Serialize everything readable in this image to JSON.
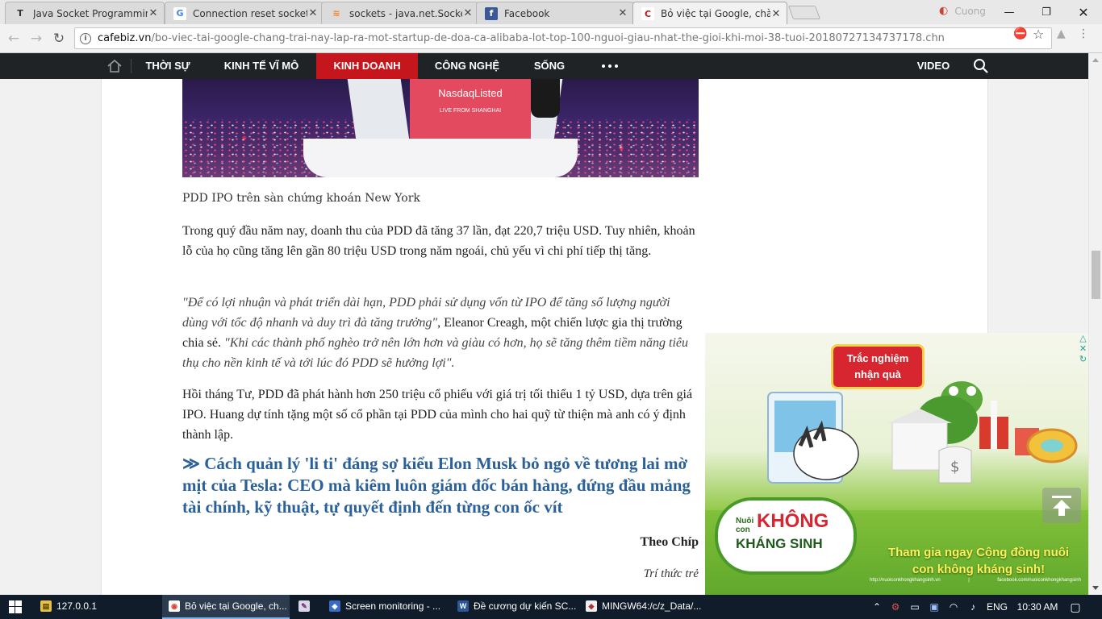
{
  "browser": {
    "tabs": [
      {
        "title": "Java Socket Programming",
        "icon": "T",
        "icon_bg": "#dbdbdb",
        "icon_fg": "#333"
      },
      {
        "title": "Connection reset socket j",
        "icon": "G",
        "icon_bg": "#ffffff",
        "icon_fg": "#4285f4"
      },
      {
        "title": "sockets - java.net.SocketE",
        "icon": "≋",
        "icon_bg": "#dbdbdb",
        "icon_fg": "#f48024"
      },
      {
        "title": "Facebook",
        "icon": "f",
        "icon_bg": "#3b5998",
        "icon_fg": "#ffffff"
      },
      {
        "title": "Bỏ việc tại Google, chàng",
        "icon": "C",
        "icon_bg": "#ffffff",
        "icon_fg": "#c4161c"
      }
    ],
    "tab_close_glyph": "✕",
    "profile_name": "Cuong",
    "url_host": "cafebiz.vn",
    "url_path": "/bo-viec-tai-google-chang-trai-nay-lap-ra-mot-startup-de-doa-ca-alibaba-lot-top-100-nguoi-giau-nhat-the-gioi-khi-moi-38-tuoi-20180727134737178.chn"
  },
  "site_nav": {
    "items": [
      "THỜI SỰ",
      "KINH TẾ VĨ MÔ",
      "KINH DOANH",
      "CÔNG NGHỆ",
      "SỐNG"
    ],
    "active_item": "KINH DOANH",
    "video_label": "VIDEO",
    "accent_color": "#c4161c"
  },
  "article": {
    "photo_screen_text": "NasdaqListed",
    "photo_screen_subtext": "LIVE FROM SHANGHAI",
    "caption": "PDD IPO trên sàn chứng khoán New York",
    "paragraph_1": "Trong quý đầu năm nay, doanh thu của PDD đã tăng 37 lần, đạt 220,7 triệu USD. Tuy nhiên, khoản lỗ của họ cũng tăng lên gần 80 triệu USD trong năm ngoái, chủ yếu vì chi phí tiếp thị tăng.",
    "quote_1": "\"Để có lợi nhuận và phát triển dài hạn, PDD phải sử dụng vốn từ IPO để tăng số lượng người dùng với tốc độ nhanh và duy trì đà tăng trưởng\"",
    "quote_attribution": ", Eleanor Creagh, một chiến lược gia thị trường chia sẻ. ",
    "quote_2": "\"Khi các thành phố nghèo trở nên lớn hơn và giàu có hơn, họ sẽ tăng thêm tiềm năng tiêu thụ cho nền kinh tế và tới lúc đó PDD sẽ hưởng lợi\".",
    "paragraph_3": "Hồi tháng Tư, PDD đã phát hành hơn 250 triệu cổ phiếu với giá trị tối thiểu 1 tỷ USD, dựa trên giá IPO. Huang dự tính tặng một số cổ phần tại PDD của mình cho hai quỹ từ thiện mà anh có ý định thành lập.",
    "related_link": "≫ Cách quản lý 'li ti' đáng sợ kiểu Elon Musk bỏ ngỏ về tương lai mờ mịt của Tesla: CEO mà kiêm luôn giám đốc bán hàng, đứng đầu mảng tài chính, kỹ thuật, tự quyết định đến từng con ốc vít",
    "source": "Theo Chíp",
    "source_2": "Trí thức trẻ",
    "link_color": "#2b6198"
  },
  "ad": {
    "sign_text": "Trắc nghiệm nhận quà",
    "logo_prefix": "Nuôi con",
    "logo_main": "KHÔNG",
    "logo_sub": "KHÁNG SINH",
    "cta": "Tham gia ngay Cộng đồng nuôi con không kháng sinh!",
    "url_left": "http://nuoiconkhongkhangsinh.vn",
    "url_sep": "|",
    "url_right": "facebook.com/nuoiconkhongkhangsinh"
  },
  "taskbar": {
    "items": [
      {
        "label": "127.0.0.1",
        "icon": "▤",
        "icon_bg": "#e8c14a",
        "icon_fg": "#5a4200"
      },
      {
        "label": "Bỏ việc tại Google, ch...",
        "icon": "◉",
        "icon_bg": "#ffffff",
        "icon_fg": "#db4437"
      },
      {
        "label": "",
        "icon": "✎",
        "icon_bg": "#d8d8e8",
        "icon_fg": "#7a2a7a"
      },
      {
        "label": "Screen monitoring - ...",
        "icon": "◆",
        "icon_bg": "#3a6bc4",
        "icon_fg": "#ffffff"
      },
      {
        "label": "Đề cương dự kiến SC...",
        "icon": "W",
        "icon_bg": "#2b579a",
        "icon_fg": "#ffffff"
      },
      {
        "label": "MINGW64:/c/z_Data/...",
        "icon": "◆",
        "icon_bg": "#f0f0f0",
        "icon_fg": "#b0303a"
      }
    ],
    "language": "ENG",
    "time": "10:30 AM"
  }
}
